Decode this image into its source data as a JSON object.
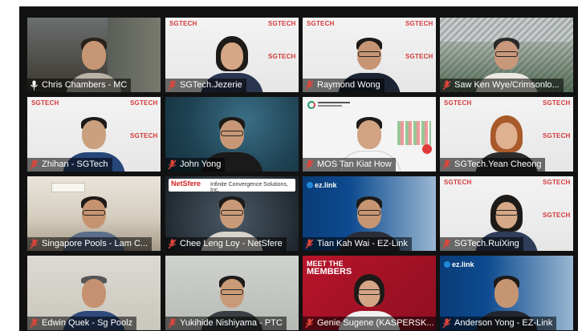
{
  "meeting": {
    "brand_watermark": "SGTECH",
    "participants": [
      {
        "label": "Chris Chambers - MC",
        "mic": "unmuted"
      },
      {
        "label": "SGTech.Jezerie",
        "mic": "muted"
      },
      {
        "label": "Raymond Wong",
        "mic": "muted"
      },
      {
        "label": "Saw Ken Wye/Crimsonlo...",
        "mic": "muted"
      },
      {
        "label": "Zhihan - SGTech",
        "mic": "muted"
      },
      {
        "label": "John Yong",
        "mic": "muted"
      },
      {
        "label": "MOS Tan Kiat How",
        "mic": "muted"
      },
      {
        "label": "SGTech.Yean Cheong",
        "mic": "muted"
      },
      {
        "label": "Singapore Pools - Lam C...",
        "mic": "muted"
      },
      {
        "label": "Chee Leng Loy - NetSfere",
        "mic": "muted"
      },
      {
        "label": "Tian Kah Wai - EZ-Link",
        "mic": "muted"
      },
      {
        "label": "SGTech.RuiXing",
        "mic": "muted"
      },
      {
        "label": "Edwin Quek - Sg Poolz",
        "mic": "muted"
      },
      {
        "label": "Yukihide Nishiyama - PTC",
        "mic": "muted"
      },
      {
        "label": "Genie Sugene (KASPERSK...",
        "mic": "muted"
      },
      {
        "label": "Anderson Yong - EZ-Link",
        "mic": "muted"
      }
    ],
    "backgrounds": {
      "netsfere_logo": "NetSfere",
      "netsfere_company": "Infinite Convergence Solutions, Inc.",
      "ezlink_logo": "ez.link",
      "meet_members_title": "MEET THE",
      "meet_members_sub": "MEMBERS"
    }
  },
  "colors": {
    "active_speaker_border": "#e8e07a",
    "muted_icon": "#e0453a",
    "brand_red": "#d43a3a"
  }
}
